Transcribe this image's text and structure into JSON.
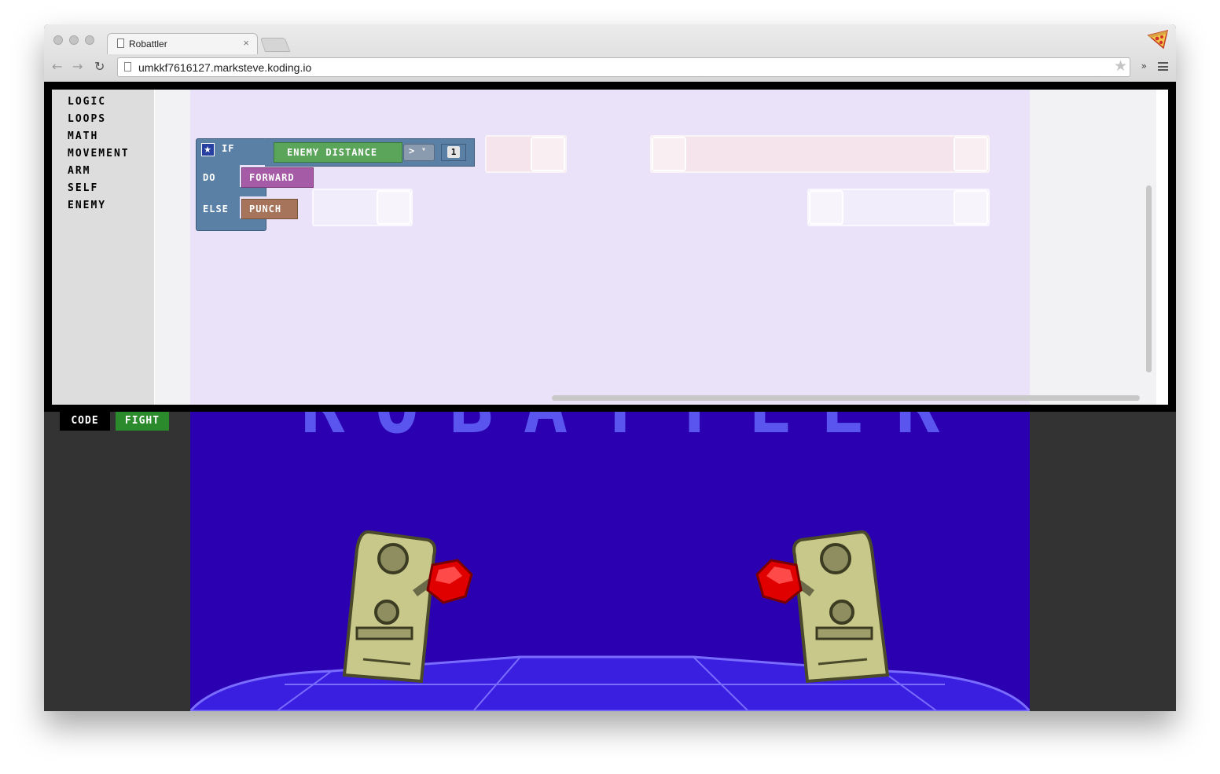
{
  "browser": {
    "tab_title": "Robattler",
    "tab_close": "×",
    "url": "umkkf7616127.marksteve.koding.io",
    "star": "★",
    "extensions": "»",
    "back": "←",
    "forward": "→",
    "reload": "↻"
  },
  "toolbox": {
    "items": [
      "LOGIC",
      "LOOPS",
      "MATH",
      "MOVEMENT",
      "ARM",
      "SELF",
      "ENEMY"
    ]
  },
  "blocks": {
    "if_label": "IF",
    "do_label": "DO",
    "else_label": "ELSE",
    "condition_sensor": "ENEMY DISTANCE",
    "operator": ">",
    "value": "1",
    "do_action": "FORWARD",
    "else_action": "PUNCH"
  },
  "game": {
    "title": "ROBATTLER"
  },
  "buttons": {
    "code": "CODE",
    "fight": "FIGHT"
  },
  "colors": {
    "arena_bg": "#2a00b0",
    "if_block": "#5b80a5",
    "sensor_block": "#5ba55b",
    "forward_block": "#a55ba5",
    "punch_block": "#a5745b",
    "fight_button": "#2b8a2b"
  }
}
